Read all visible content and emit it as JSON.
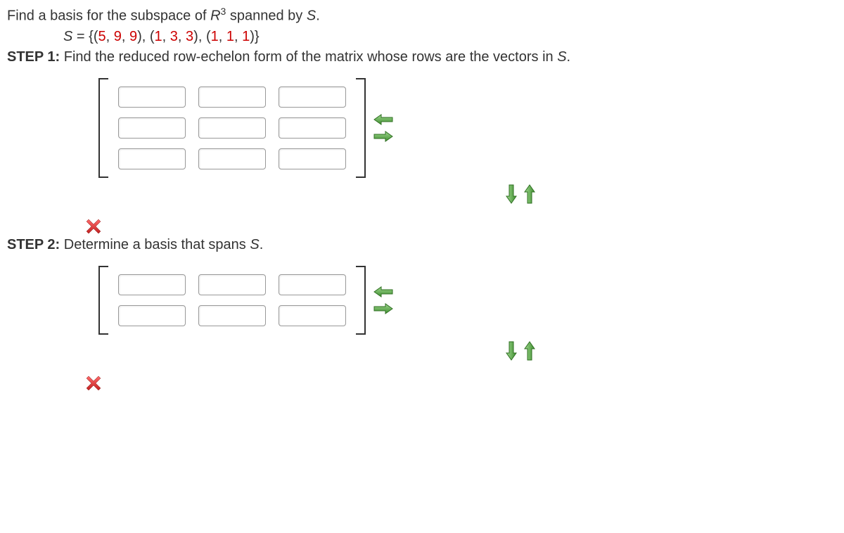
{
  "question": {
    "text_pre": "Find a basis for the subspace of ",
    "R": "R",
    "exp": "3",
    "text_mid": " spanned by ",
    "S": "S",
    "period": "."
  },
  "set_def": {
    "S": "S",
    "eq": " = ",
    "open": "{(",
    "v1a": "5",
    "v1b": "9",
    "v1c": "9",
    "sep": "), (",
    "v2a": "1",
    "v2b": "3",
    "v2c": "3",
    "v3a": "1",
    "v3b": "1",
    "v3c": "1",
    "close": ")}",
    "comma": ", "
  },
  "step1": {
    "label": "STEP 1:",
    "text": " Find the reduced row-echelon form of the matrix whose rows are the vectors in ",
    "S": "S",
    "period": "."
  },
  "step2": {
    "label": "STEP 2:",
    "text": " Determine a basis that spans ",
    "S": "S",
    "period": "."
  }
}
